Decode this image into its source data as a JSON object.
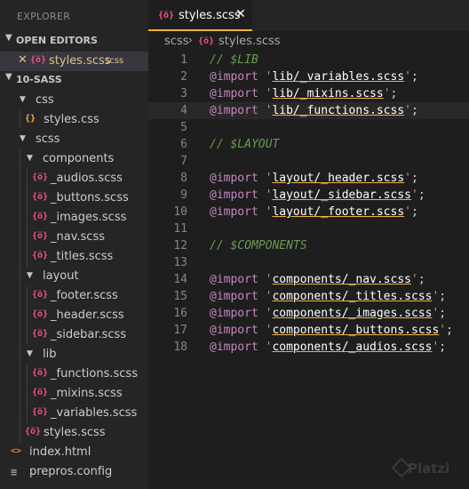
{
  "sidebar": {
    "title": "EXPLORER",
    "open_editors": {
      "label": "OPEN EDITORS",
      "item": {
        "name": "styles.scss",
        "dir": "scss"
      }
    },
    "workspace": "10-SASS",
    "tree": [
      {
        "label": "css",
        "type": "folder"
      },
      {
        "label": "styles.css",
        "type": "css"
      },
      {
        "label": "scss",
        "type": "folder"
      },
      {
        "label": "components",
        "type": "folder"
      },
      {
        "label": "_audios.scss",
        "type": "scss"
      },
      {
        "label": "_buttons.scss",
        "type": "scss"
      },
      {
        "label": "_images.scss",
        "type": "scss"
      },
      {
        "label": "_nav.scss",
        "type": "scss"
      },
      {
        "label": "_titles.scss",
        "type": "scss"
      },
      {
        "label": "layout",
        "type": "folder"
      },
      {
        "label": "_footer.scss",
        "type": "scss"
      },
      {
        "label": "_header.scss",
        "type": "scss"
      },
      {
        "label": "_sidebar.scss",
        "type": "scss"
      },
      {
        "label": "lib",
        "type": "folder"
      },
      {
        "label": "_functions.scss",
        "type": "scss"
      },
      {
        "label": "_mixins.scss",
        "type": "scss"
      },
      {
        "label": "_variables.scss",
        "type": "scss"
      },
      {
        "label": "styles.scss",
        "type": "scss"
      },
      {
        "label": "index.html",
        "type": "html"
      },
      {
        "label": "prepros.config",
        "type": "config"
      }
    ]
  },
  "editor": {
    "tab": {
      "label": "styles.scss",
      "close": "✕"
    },
    "breadcrumb": [
      "scss",
      "styles.scss"
    ],
    "lines": [
      {
        "n": "1",
        "kind": "comment",
        "text": "// $LIB"
      },
      {
        "n": "2",
        "kind": "import",
        "path": "lib/_variables.scss"
      },
      {
        "n": "3",
        "kind": "import",
        "path": "lib/_mixins.scss"
      },
      {
        "n": "4",
        "kind": "import",
        "path": "lib/_functions.scss"
      },
      {
        "n": "5",
        "kind": "blank"
      },
      {
        "n": "6",
        "kind": "comment",
        "text": "// $LAYOUT"
      },
      {
        "n": "7",
        "kind": "blank"
      },
      {
        "n": "8",
        "kind": "import",
        "path": "layout/_header.scss"
      },
      {
        "n": "9",
        "kind": "import",
        "path": "layout/_sidebar.scss"
      },
      {
        "n": "10",
        "kind": "import",
        "path": "layout/_footer.scss"
      },
      {
        "n": "11",
        "kind": "blank"
      },
      {
        "n": "12",
        "kind": "comment",
        "text": "// $COMPONENTS"
      },
      {
        "n": "13",
        "kind": "blank"
      },
      {
        "n": "14",
        "kind": "import",
        "path": "components/_nav.scss"
      },
      {
        "n": "15",
        "kind": "import",
        "path": "components/_titles.scss"
      },
      {
        "n": "16",
        "kind": "import",
        "path": "components/_images.scss"
      },
      {
        "n": "17",
        "kind": "import",
        "path": "components/_buttons.scss"
      },
      {
        "n": "18",
        "kind": "import",
        "path": "components/_audios.scss"
      }
    ],
    "current_line": "4"
  },
  "watermark": "Platzi",
  "colors": {
    "accent": "#f0b43c",
    "scss_icon": "#f55385",
    "css_icon": "#f6b042",
    "comment": "#6a9955",
    "keyword": "#c586c0",
    "string": "#ce9178"
  }
}
